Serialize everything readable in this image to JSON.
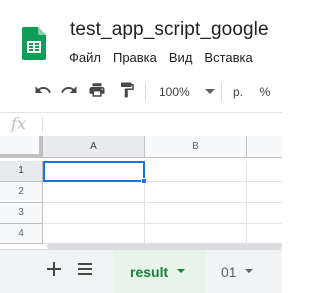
{
  "header": {
    "title": "test_app_script_google",
    "menu": [
      "Файл",
      "Правка",
      "Вид",
      "Вставка"
    ]
  },
  "toolbar": {
    "undo_icon": "undo-icon",
    "redo_icon": "redo-icon",
    "print_icon": "print-icon",
    "paint_format_icon": "paint-format-icon",
    "zoom": "100%",
    "currency": "р.",
    "percent": "%"
  },
  "formula_bar": {
    "fx_label": "fx",
    "value": ""
  },
  "grid": {
    "columns": [
      "A",
      "B"
    ],
    "rows": [
      "1",
      "2",
      "3",
      "4"
    ],
    "selected_cell": "A1"
  },
  "sheets": {
    "add_icon": "plus-icon",
    "list_icon": "list-icon",
    "tabs": [
      {
        "label": "result",
        "active": true
      },
      {
        "label": "01",
        "active": false
      }
    ]
  },
  "colors": {
    "accent": "#1a73e8",
    "sheets_green": "#188038",
    "logo_green": "#0f9d58"
  }
}
